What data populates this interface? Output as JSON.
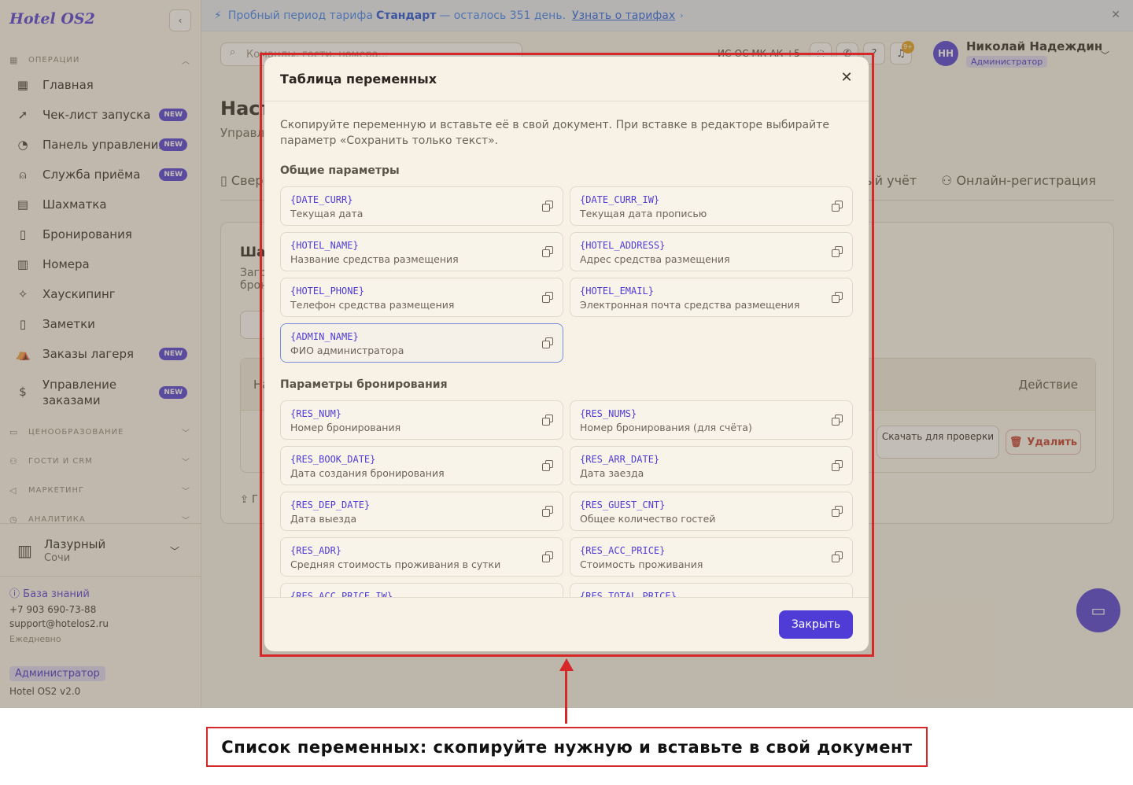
{
  "banner": {
    "text_before": "Пробный период тарифа",
    "plan": "Стандарт",
    "text_after": "— осталось 351 день.",
    "link": "Узнать о тарифах"
  },
  "sidebar": {
    "logo": "Hotel OS2",
    "sections": [
      {
        "label": "Операции",
        "icon": "grid-icon"
      },
      {
        "label": "Ценообразование",
        "icon": "wallet-icon"
      },
      {
        "label": "Гости и CRM",
        "icon": "users-icon"
      },
      {
        "label": "Маркетинг",
        "icon": "megaphone-icon"
      },
      {
        "label": "Аналитика",
        "icon": "chart-icon"
      }
    ],
    "items": [
      {
        "label": "Главная",
        "icon": "dashboard-icon",
        "badge": ""
      },
      {
        "label": "Чек-лист запуска",
        "icon": "rocket-icon",
        "badge": "NEW"
      },
      {
        "label": "Панель управления",
        "icon": "gauge-icon",
        "badge": "NEW"
      },
      {
        "label": "Служба приёма",
        "icon": "bell-icon",
        "badge": "NEW"
      },
      {
        "label": "Шахматка",
        "icon": "table-icon",
        "badge": ""
      },
      {
        "label": "Бронирования",
        "icon": "document-icon",
        "badge": ""
      },
      {
        "label": "Номера",
        "icon": "building-icon",
        "badge": ""
      },
      {
        "label": "Хаускипинг",
        "icon": "sparkle-icon",
        "badge": ""
      },
      {
        "label": "Заметки",
        "icon": "note-icon",
        "badge": ""
      },
      {
        "label": "Заказы лагеря",
        "icon": "tent-icon",
        "badge": "NEW"
      },
      {
        "label": "Управление",
        "label2": "заказами",
        "icon": "dollar-icon",
        "badge": "NEW"
      }
    ],
    "hotel": {
      "name": "Лазурный",
      "city": "Сочи"
    },
    "knowledge_base": "База знаний",
    "phone": "+7 903 690-73-88",
    "email": "support@hotelos2.ru",
    "hours": "Ежедневно",
    "role": "Администратор",
    "version": "Hotel OS2 v2.0"
  },
  "header": {
    "search_placeholder": "Команды, гости, номера...",
    "hotel_code": "ИС-ОС МК-АК +5",
    "notifications_count": "9+",
    "user": {
      "initials": "НН",
      "name": "Николай Надеждин",
      "role": "Администратор"
    }
  },
  "page": {
    "title": "Настройки",
    "subtitle": "Управление",
    "tabs": [
      "Сверка",
      "ый учёт",
      "Онлайн-регистрация"
    ],
    "card_title": "Шаблоны",
    "card_sub1": "Загрузите",
    "card_sub2": "брон",
    "col_action": "Действие",
    "col_name": "На",
    "download_check": "Скачать для проверки",
    "delete": "Удалить",
    "upload": "Г"
  },
  "modal": {
    "title": "Таблица переменных",
    "intro": "Скопируйте переменную и вставьте её в свой документ. При вставке в редакторе выбирайте параметр «Сохранить только текст».",
    "groups": [
      {
        "title": "Общие параметры",
        "vars": [
          {
            "key": "{DATE_CURR}",
            "desc": "Текущая дата"
          },
          {
            "key": "{DATE_CURR_IW}",
            "desc": "Текущая дата прописью"
          },
          {
            "key": "{HOTEL_NAME}",
            "desc": "Название средства размещения"
          },
          {
            "key": "{HOTEL_ADDRESS}",
            "desc": "Адрес средства размещения"
          },
          {
            "key": "{HOTEL_PHONE}",
            "desc": "Телефон средства размещения"
          },
          {
            "key": "{HOTEL_EMAIL}",
            "desc": "Электронная почта средства размещения"
          },
          {
            "key": "{ADMIN_NAME}",
            "desc": "ФИО администратора"
          }
        ]
      },
      {
        "title": "Параметры бронирования",
        "vars": [
          {
            "key": "{RES_NUM}",
            "desc": "Номер бронирования"
          },
          {
            "key": "{RES_NUMS}",
            "desc": "Номер бронирования (для счёта)"
          },
          {
            "key": "{RES_BOOK_DATE}",
            "desc": "Дата создания бронирования"
          },
          {
            "key": "{RES_ARR_DATE}",
            "desc": "Дата заезда"
          },
          {
            "key": "{RES_DEP_DATE}",
            "desc": "Дата выезда"
          },
          {
            "key": "{RES_GUEST_CNT}",
            "desc": "Общее количество гостей"
          },
          {
            "key": "{RES_ADR}",
            "desc": "Средняя стоимость проживания в сутки"
          },
          {
            "key": "{RES_ACC_PRICE}",
            "desc": "Стоимость проживания"
          },
          {
            "key": "{RES_ACC_PRICE_IW}",
            "desc": ""
          },
          {
            "key": "{RES_TOTAL_PRICE}",
            "desc": ""
          }
        ]
      }
    ],
    "close_label": "Закрыть"
  },
  "annotation": {
    "caption": "Список переменных: скопируйте нужную и вставьте в свой документ"
  },
  "colors": {
    "accent": "#4f3bd6",
    "annotation": "#d62828"
  }
}
